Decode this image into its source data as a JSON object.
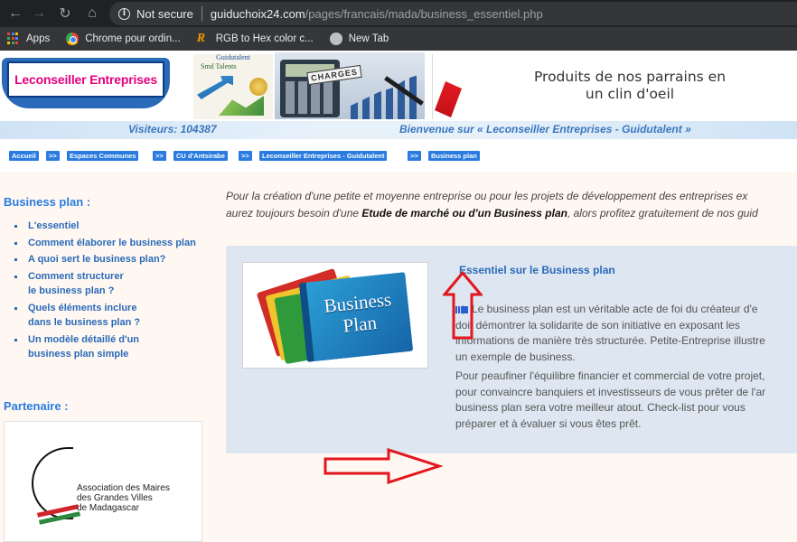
{
  "browser": {
    "security_label": "Not secure",
    "url_host": "guiduchoix24.com",
    "url_path": "/pages/francais/mada/business_essentiel.php",
    "bookmarks": [
      {
        "label": "Apps",
        "icon": "apps-icon"
      },
      {
        "label": "Chrome pour ordin...",
        "icon": "chrome-icon"
      },
      {
        "label": "RGB to Hex color c...",
        "icon": "r-icon"
      },
      {
        "label": "New Tab",
        "icon": "globe-icon"
      }
    ]
  },
  "banner": {
    "logo_text": "Leconseiller Entreprises",
    "img1_title": "Guidutalent",
    "img1_sub": "Smd  Talents",
    "charges_label": "CHARGES",
    "sponsor_line1": "Produits de nos parrains en",
    "sponsor_line2": "un clin d'oeil"
  },
  "status": {
    "visitors": "Visiteurs: 104387",
    "welcome": "Bienvenue sur « Leconseiller Entreprises - Guidutalent »"
  },
  "breadcrumb": [
    {
      "label": "Accueil"
    },
    {
      "label": ">>"
    },
    {
      "label": "Espaces Communes"
    },
    {
      "label": ">>"
    },
    {
      "label": "CU d'Antsirabe"
    },
    {
      "label": ">>"
    },
    {
      "label": "Leconseiller Entreprises - Guidutalent"
    },
    {
      "label": ">>"
    },
    {
      "label": "Business plan"
    }
  ],
  "sidebar": {
    "title": "Business plan :",
    "items": [
      {
        "lines": [
          "L'essentiel"
        ]
      },
      {
        "lines": [
          "Comment élaborer le business plan"
        ]
      },
      {
        "lines": [
          "A quoi sert le business plan?"
        ]
      },
      {
        "lines": [
          "Comment structurer",
          "le business plan ?"
        ]
      },
      {
        "lines": [
          "Quels éléments inclure",
          "dans le business plan ?"
        ]
      },
      {
        "lines": [
          "Un modèle détaillé d'un",
          "business plan simple"
        ]
      }
    ],
    "partner_title": "Partenaire :",
    "partner_lines": [
      "Association des Maires",
      "des Grandes Villes",
      "de Madagascar"
    ]
  },
  "intro": {
    "line1": "Pour la création d'une petite et moyenne entreprise ou pour les projets de développement des entreprises ex",
    "line2_a": "aurez toujours besoin d'une ",
    "line2_b": "Etude de marché ou d'un Business plan",
    "line2_c": ", alors profitez gratuitement de nos guid"
  },
  "card": {
    "image_title_1": "Business",
    "image_title_2": "Plan",
    "heading": "Essentiel sur le Business plan",
    "para1": [
      "Le business plan est un véritable acte de foi du créateur d'e",
      "doit démontrer la solidarite de son initiative en exposant les",
      "informations de manière très structurée. Petite-Entreprise illustre",
      "un exemple de business."
    ],
    "para2": [
      "Pour peaufiner l'équilibre financier et commercial de votre projet,",
      "pour convaincre banquiers et investisseurs de vous prêter de l'ar",
      "business plan sera votre meilleur atout. Check-list pour vous",
      "préparer et à évaluer si vous êtes prêt."
    ]
  },
  "colors": {
    "link_blue": "#2a7be0",
    "annotation_red": "#e3161d",
    "logo_magenta": "#e5007e"
  }
}
